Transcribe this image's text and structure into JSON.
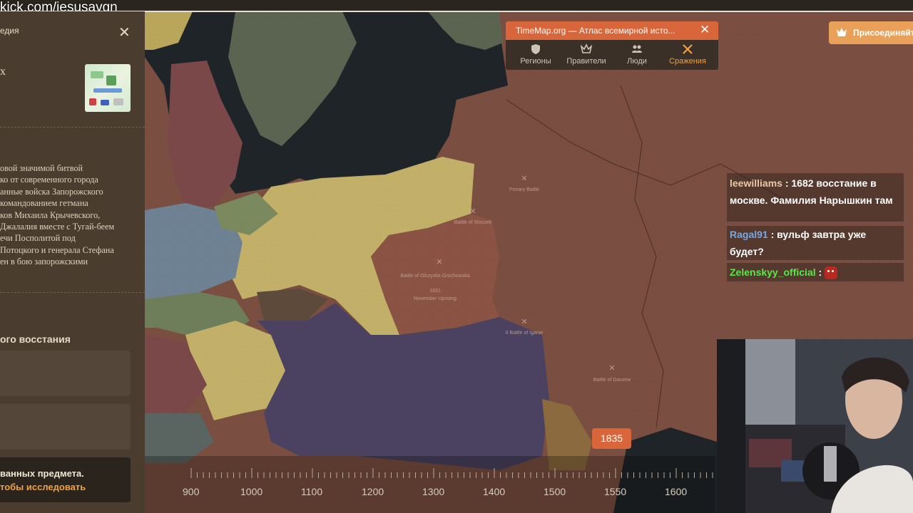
{
  "stream": {
    "url": "kick.com/jesusavgn"
  },
  "panel": {
    "title_fragment": "едия",
    "name_fragment": "х",
    "description": "овой значимой битвой\nко от современного города\nанные войска Запорожского\nкомандованием гетмана\nков Михаила Крычевского,\nДжалалия вместе с Тугай-беем\nечи Посполитой под\nПотоцкого и генерала Стефана\nен в бою запорожскими",
    "section_title": "ого восстания",
    "note_line1": "ванных предмета.",
    "note_line2": "тобы исследовать"
  },
  "timemap": {
    "title": "TimeMap.org — Атлас всемирной исто...",
    "tabs": [
      {
        "label": "Регионы",
        "icon": "shield-icon"
      },
      {
        "label": "Правители",
        "icon": "crown-icon"
      },
      {
        "label": "Люди",
        "icon": "people-icon"
      },
      {
        "label": "Сражения",
        "icon": "crossed-swords-icon"
      }
    ],
    "active_tab": "Сражения"
  },
  "join_button": {
    "label": "Присоединяйтесь"
  },
  "chat": {
    "messages": [
      {
        "user": "leewilliams",
        "text": "1682 восстание в москве. Фамилия Нарышкин там"
      },
      {
        "user": "Ragal91",
        "text": "вульф завтра уже будет?"
      },
      {
        "user": "Zelenskyy_official",
        "text": ""
      }
    ]
  },
  "map_labels": {
    "battle_1": "Battle of Olszynka Grochowska",
    "battle_1_year": "1831",
    "battle_1_sub": "November Uprising",
    "battle_2": "Ponary Battle",
    "battle_3": "Battle of Daszew",
    "battle_4": "II Battle of Iganie",
    "battle_5": "Battle of Stoczek"
  },
  "timeline": {
    "current_year": "1835",
    "years": [
      "900",
      "1000",
      "1100",
      "1200",
      "1300",
      "1400",
      "1500",
      "1550",
      "1600"
    ]
  },
  "colors": {
    "accent": "#d9663a",
    "panel_bg": "#4a3d2f",
    "russia": "#7a4e40",
    "prussia": "#c2b068",
    "austria": "#4a4260",
    "sea": "#1f2429"
  }
}
